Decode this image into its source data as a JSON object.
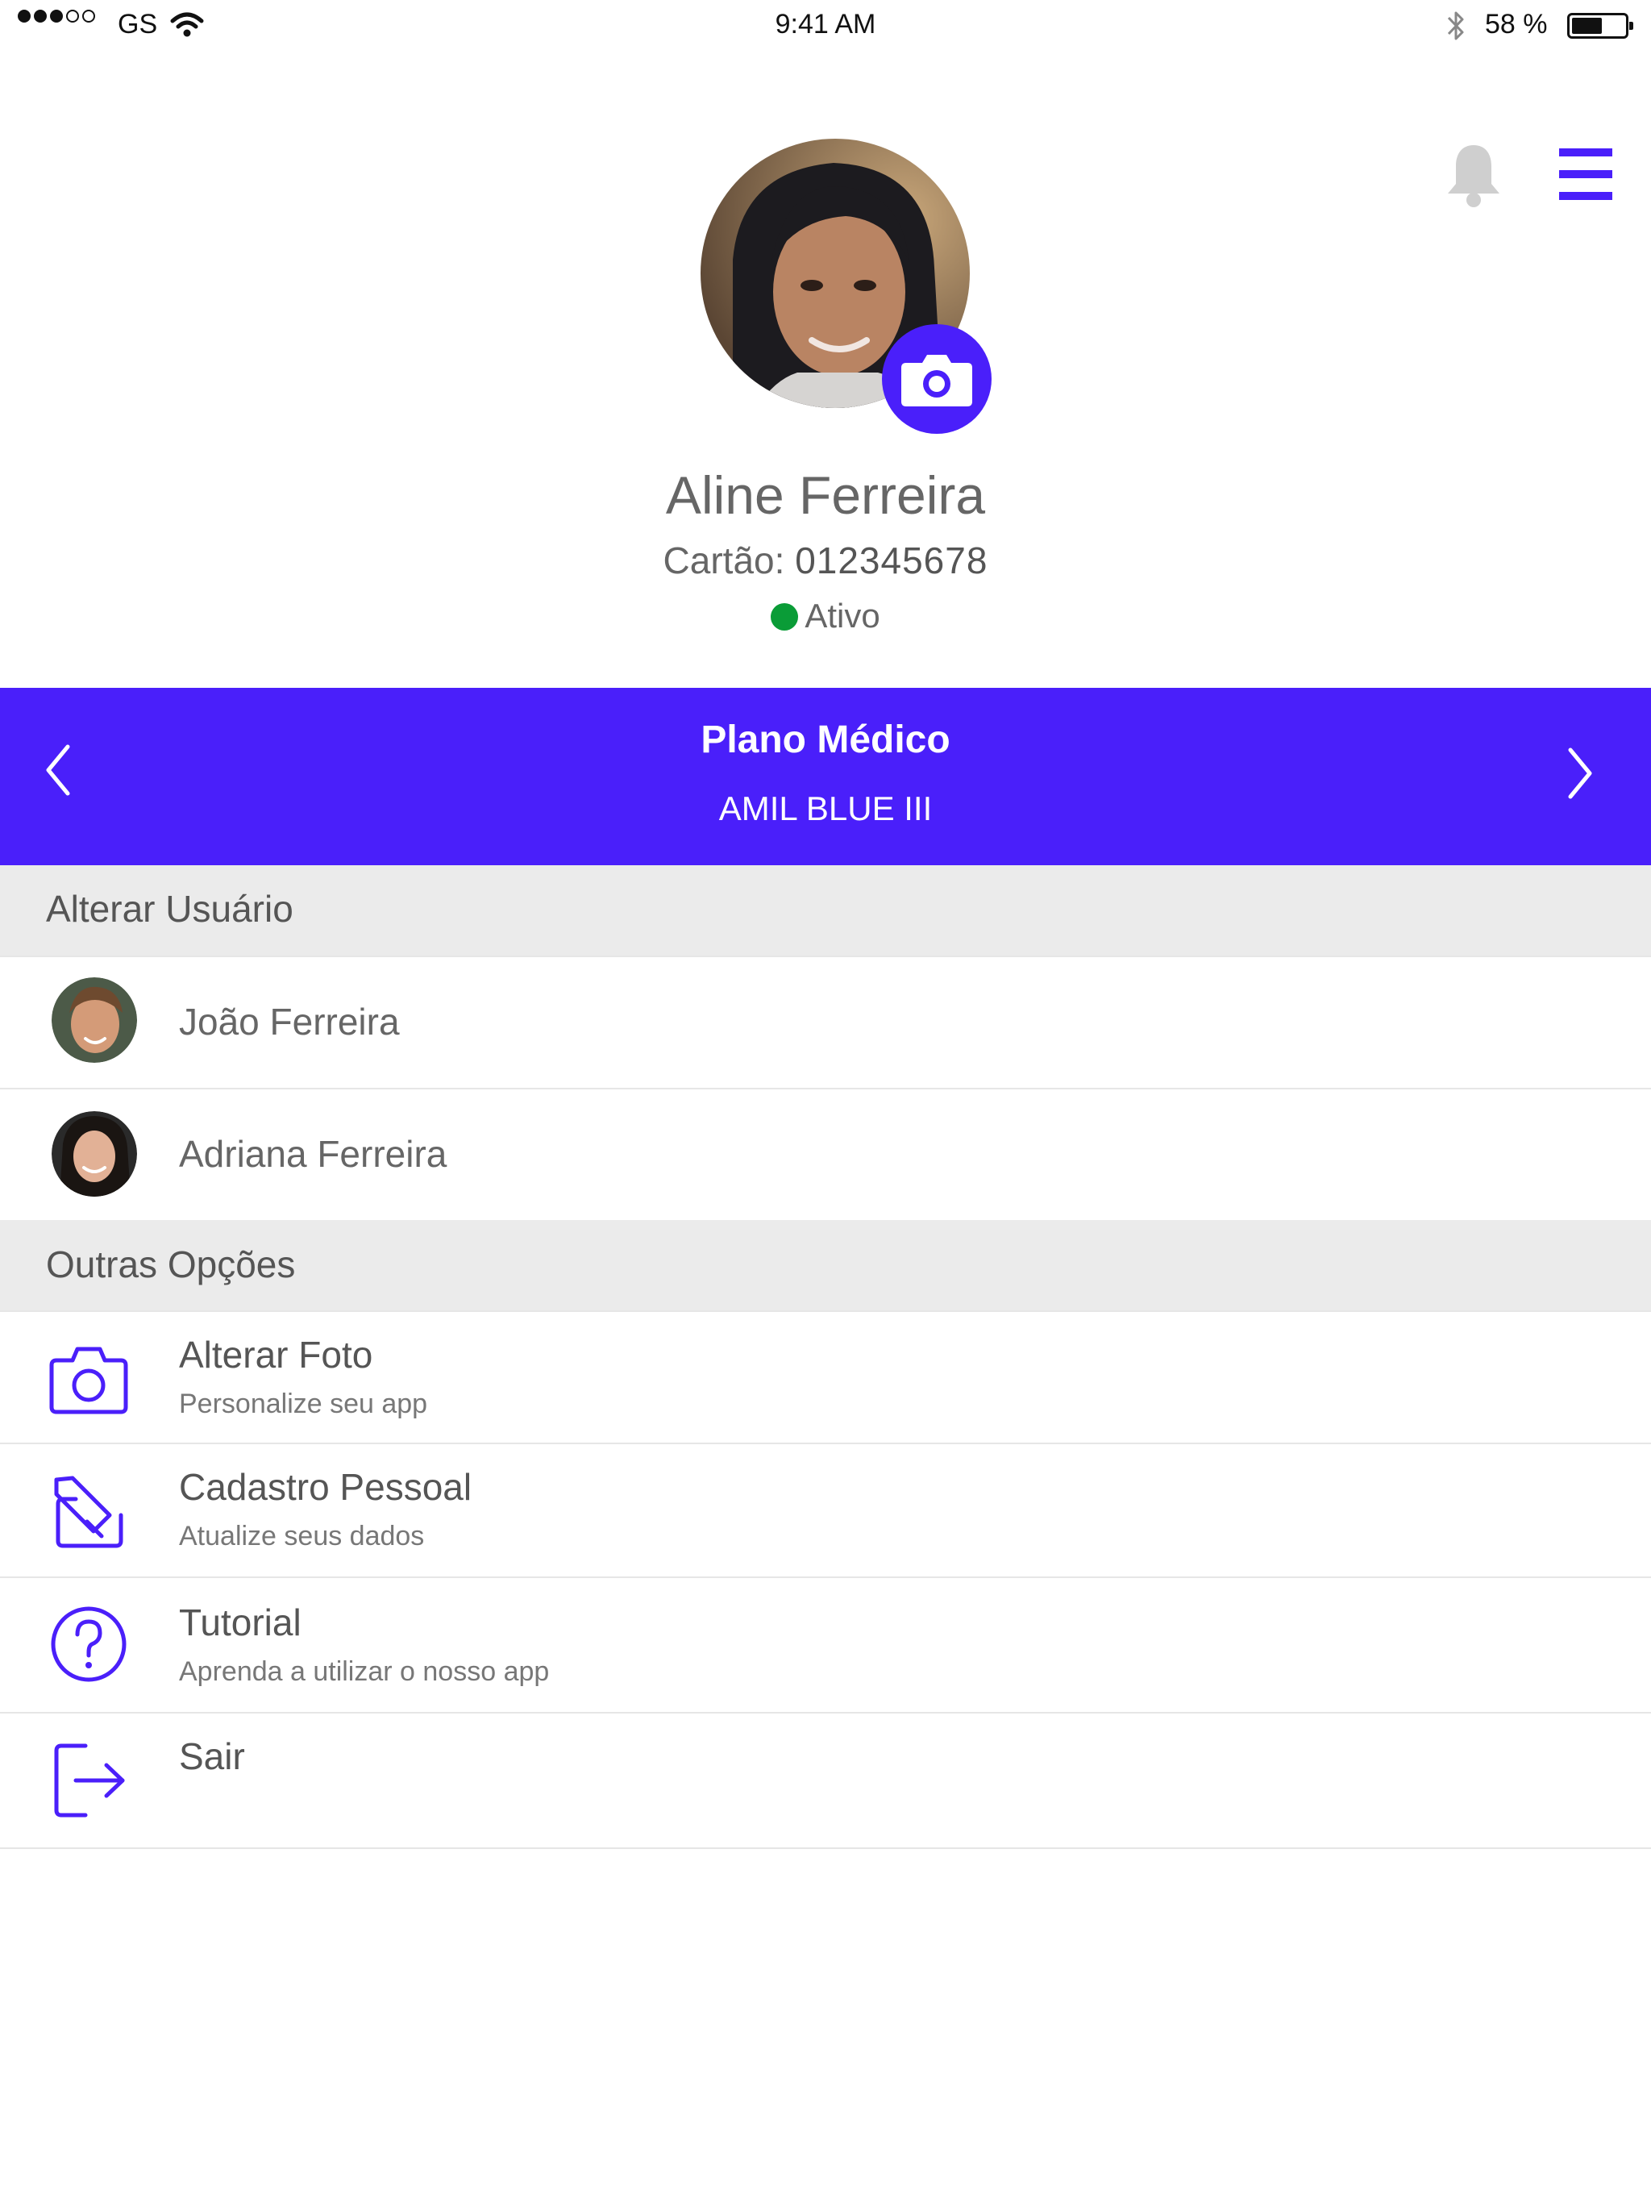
{
  "status_bar": {
    "carrier": "GS",
    "time": "9:41 AM",
    "battery": "58 %",
    "battery_level": 0.58
  },
  "profile": {
    "name": "Aline Ferreira",
    "card_label": "Cartão: ",
    "card_number": "012345678",
    "status": "Ativo",
    "status_color": "#0a9c37"
  },
  "plan": {
    "title": "Plano Médico",
    "name": "AMIL BLUE III"
  },
  "colors": {
    "accent": "#4a1ffa"
  },
  "users_section": {
    "label": "Alterar Usuário",
    "users": [
      {
        "name": "João Ferreira"
      },
      {
        "name": "Adriana Ferreira"
      }
    ]
  },
  "options_section": {
    "label": "Outras Opções",
    "items": [
      {
        "title": "Alterar Foto",
        "subtitle": "Personalize seu app",
        "icon": "camera-icon"
      },
      {
        "title": "Cadastro Pessoal",
        "subtitle": "Atualize seus dados",
        "icon": "edit-icon"
      },
      {
        "title": "Tutorial",
        "subtitle": "Aprenda a utilizar o nosso app",
        "icon": "help-icon"
      },
      {
        "title": "Sair",
        "subtitle": "",
        "icon": "logout-icon"
      }
    ]
  }
}
